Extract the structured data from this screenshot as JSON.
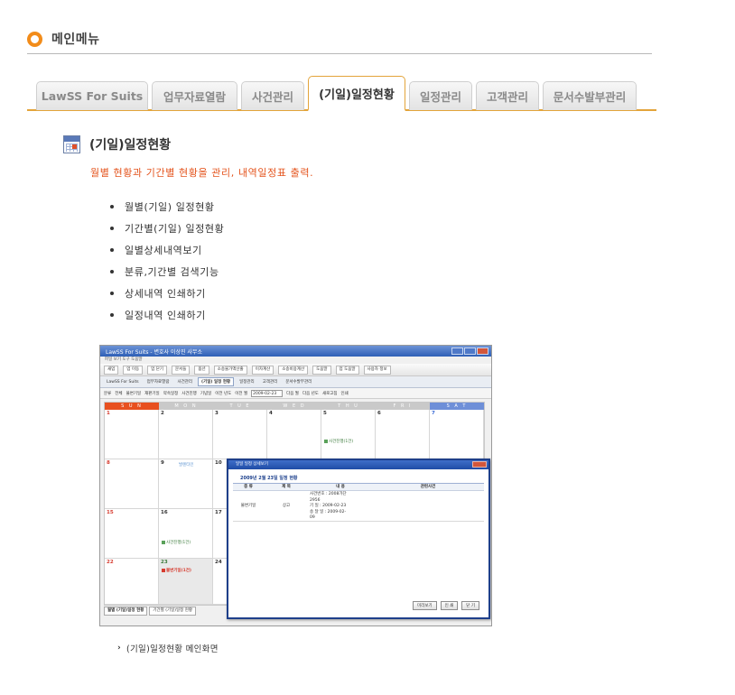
{
  "heading": {
    "title": "메인메뉴"
  },
  "tabs": [
    {
      "label": "LawSS For Suits",
      "active": false
    },
    {
      "label": "업무자료열람",
      "active": false
    },
    {
      "label": "사건관리",
      "active": false
    },
    {
      "label": "(기일)일정현황",
      "active": true
    },
    {
      "label": "일정관리",
      "active": false
    },
    {
      "label": "고객관리",
      "active": false
    },
    {
      "label": "문서수발부관리",
      "active": false
    }
  ],
  "section": {
    "title": "(기일)일정현황",
    "description": "월별 현황과 기간별 현황을 관리, 내역일정표 출력.",
    "features": [
      "월별(기일) 일정현황",
      "기간별(기일) 일정현황",
      "일별상세내역보기",
      "분류,기간별 검색기능",
      "상세내역 인쇄하기",
      "일정내역 인쇄하기"
    ]
  },
  "screenshot": {
    "window_title": "LawSS For Suits - 변호사 이상진 사무소",
    "menu": "파일  보기  도구  도움말",
    "toolbar": [
      "새업",
      "업 이동",
      "업 닫기",
      "문서들",
      "옵션",
      "소송물가액산출",
      "이자계산",
      "소송비용계산",
      "도움말",
      "업 도움말",
      "사용자 정보"
    ],
    "tabs": [
      "LawSS For Suits",
      "업무자료열람",
      "사건관리",
      "(기일) 일정 현황",
      "일정관리",
      "고객관리",
      "문서수발부관리"
    ],
    "filter": {
      "label": "분류",
      "options": [
        "전체",
        "불변기일",
        "재판기일",
        "약속일정",
        "사건진행",
        "기념일"
      ],
      "prev_year": "이전 년도",
      "prev_month": "이전 월",
      "date": "2009-02-23",
      "next_month": "다음 월",
      "next_year": "다음 년도",
      "refresh": "새로고침",
      "print": "인쇄"
    },
    "weekdays": [
      "S U N",
      "M O N",
      "T U E",
      "W E D",
      "T H U",
      "F R I",
      "S A T"
    ],
    "weekday_colors": [
      "#e8501f",
      "#c9c9c9",
      "#c9c9c9",
      "#c9c9c9",
      "#c9c9c9",
      "#c9c9c9",
      "#6e8fd8"
    ],
    "days": [
      "1",
      "2",
      "3",
      "4",
      "5",
      "6",
      "7",
      "8",
      "9",
      "10",
      "15",
      "16",
      "17",
      "22",
      "23",
      "24"
    ],
    "events": {
      "thu5": "사건진행(1건)",
      "mon9": "발렌타인",
      "mon16": "사건진행(1건)",
      "mon23": "불변기일(1건)"
    },
    "bottom_tabs": [
      "월별 (기일)일정 현황",
      "기간별 (기일)일정 현황"
    ],
    "dialog": {
      "title": "일일 일정 상세보기",
      "subtitle": "2009년 2월 23일 일정 현황",
      "columns": [
        "종 류",
        "제 목",
        "내 용",
        "관련사건"
      ],
      "row": {
        "type": "불변기일",
        "subject": "상고",
        "content": [
          "사건번호 : 2008가단",
          "2956",
          "기   일 : 2009-02-23",
          "송 달 일 : 2009-02-",
          "09"
        ]
      },
      "buttons": [
        "미리보기",
        "인 쇄",
        "닫 기"
      ]
    }
  },
  "caption": "(기일)일정현황 메인화면"
}
